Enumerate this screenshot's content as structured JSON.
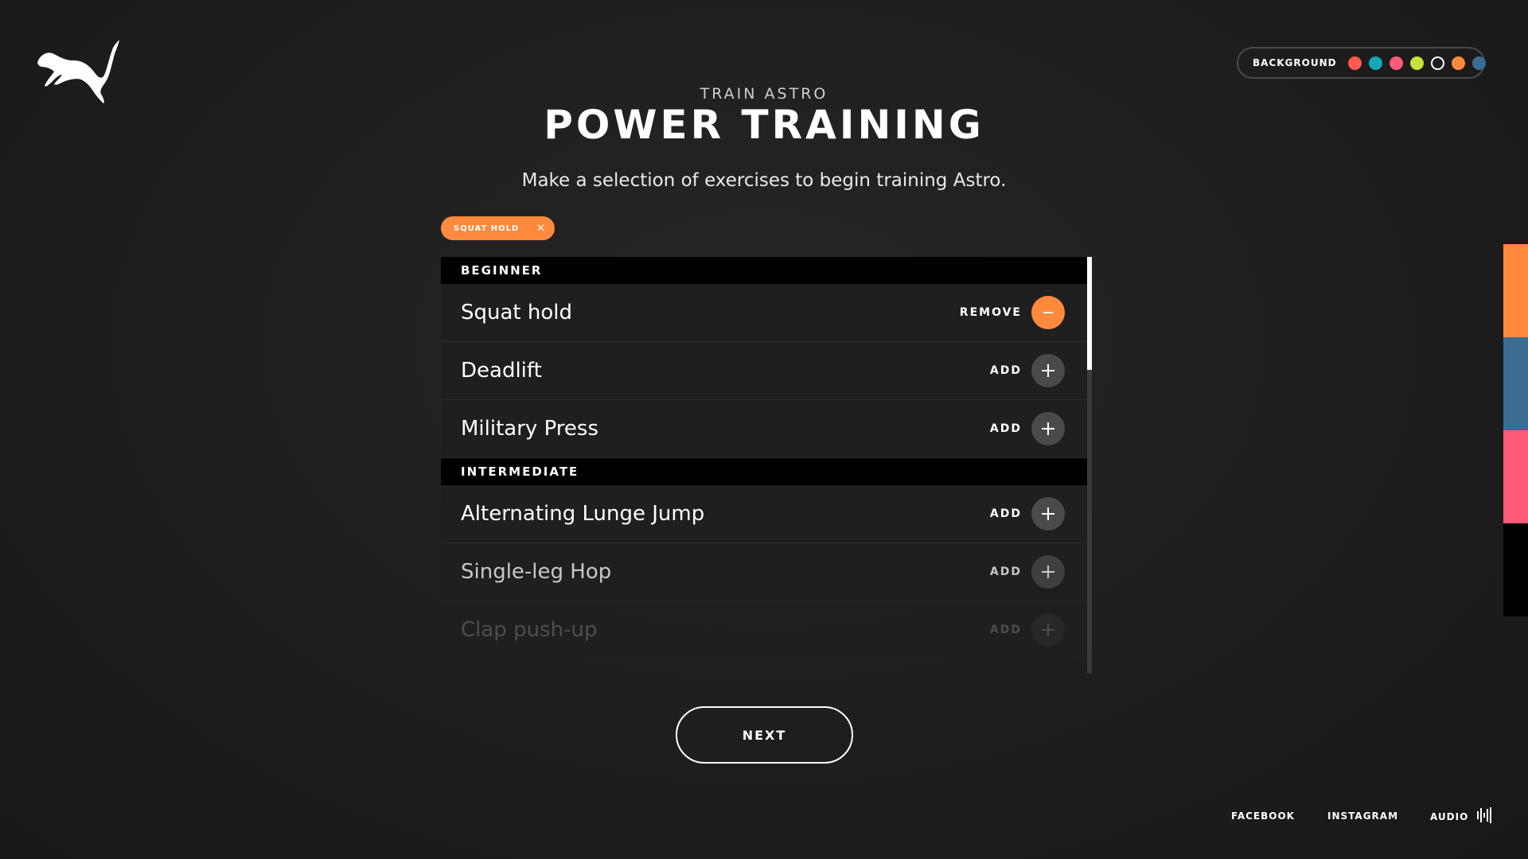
{
  "brand": {
    "logo_icon": "puma-cat-logo"
  },
  "background_picker": {
    "label": "BACKGROUND",
    "swatches": [
      {
        "color": "#ff5a4e",
        "selected": false
      },
      {
        "color": "#15a8b8",
        "selected": false
      },
      {
        "color": "#ff5a78",
        "selected": false
      },
      {
        "color": "#c8e23a",
        "selected": false
      },
      {
        "color": "#1e1e1e",
        "selected": true
      },
      {
        "color": "#ff8a3d",
        "selected": false
      },
      {
        "color": "#3b6c93",
        "selected": false
      }
    ]
  },
  "header": {
    "eyebrow": "TRAIN ASTRO",
    "title": "POWER TRAINING",
    "subtitle": "Make a selection of exercises to begin training Astro."
  },
  "selected_chips": [
    {
      "label": "SQUAT HOLD",
      "close_icon": "close-icon"
    }
  ],
  "sections": [
    {
      "title": "BEGINNER",
      "items": [
        {
          "name": "Squat hold",
          "action": "REMOVE",
          "state": "selected"
        },
        {
          "name": "Deadlift",
          "action": "ADD",
          "state": "available"
        },
        {
          "name": "Military Press",
          "action": "ADD",
          "state": "available"
        }
      ]
    },
    {
      "title": "INTERMEDIATE",
      "items": [
        {
          "name": "Alternating Lunge Jump",
          "action": "ADD",
          "state": "available"
        },
        {
          "name": "Single-leg Hop",
          "action": "ADD",
          "state": "available"
        },
        {
          "name": "Clap push-up",
          "action": "ADD",
          "state": "available"
        }
      ]
    }
  ],
  "next_button": {
    "label": "NEXT"
  },
  "side_accent": {
    "colors": [
      "#ff8a3d",
      "#3b6c93",
      "#ff5a78",
      "#000000"
    ]
  },
  "footer": {
    "facebook": "FACEBOOK",
    "instagram": "INSTAGRAM",
    "audio": "AUDIO",
    "audio_icon": "audio-bars-icon"
  },
  "colors": {
    "accent": "#ff8a3d",
    "background": "#1e1e1e",
    "row_bg": "#1f1f1f",
    "section_bg": "#000000"
  }
}
